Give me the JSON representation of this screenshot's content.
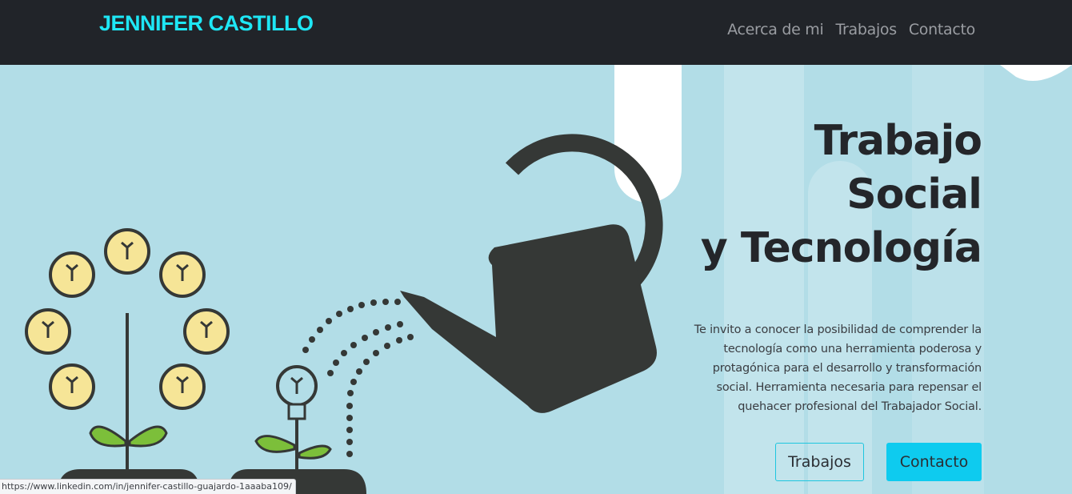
{
  "navbar": {
    "brand": "JENNIFER CASTILLO",
    "links": [
      "Acerca de mi",
      "Trabajos",
      "Contacto"
    ]
  },
  "hero": {
    "title_lines": [
      "Trabajo",
      "Social",
      "y Tecnología"
    ],
    "description": "Te invito a conocer la posibilidad de comprender la tecnología como una herramienta poderosa y protagónica para el desarrollo y transformación social. Herramienta necesaria para repensar el quehacer profesional del Trabajador Social.",
    "buttons": {
      "primary": "Trabajos",
      "secondary": "Contacto"
    }
  },
  "status_bar": {
    "url": "https://www.linkedin.com/in/jennifer-castillo-guajardo-1aaaba109/"
  },
  "colors": {
    "navbar_bg": "#212429",
    "brand": "#1ee7f5",
    "hero_bg": "#b2dde7",
    "accent_button": "#0ecbef",
    "watering_can": "#353836",
    "bulb_fill": "#f6e597",
    "leaf_green": "#7cbf3a"
  },
  "icons": [
    "watering-can-icon",
    "lightbulb-plant-icon",
    "small-lightbulb-plant-icon"
  ]
}
